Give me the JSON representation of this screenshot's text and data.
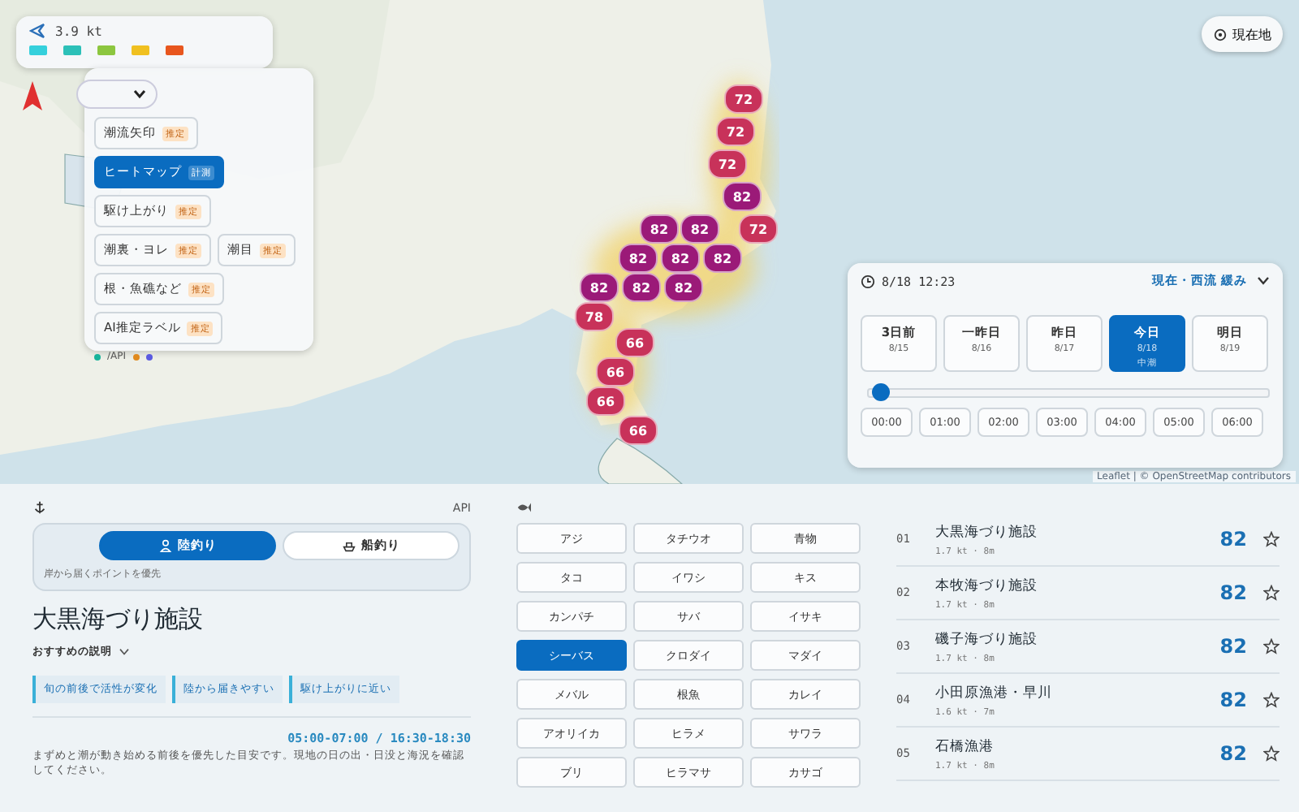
{
  "map": {
    "speed": "3.9 kt",
    "legend": [
      {
        "color": "#35d0dc"
      },
      {
        "color": "#2cc0b8"
      },
      {
        "color": "#8cc63f"
      },
      {
        "color": "#f0c020"
      },
      {
        "color": "#e8561e"
      }
    ],
    "markers": [
      {
        "label": "72"
      },
      {
        "label": "72"
      },
      {
        "label": "72"
      },
      {
        "label": "82"
      },
      {
        "label": "82"
      },
      {
        "label": "82"
      },
      {
        "label": "72"
      },
      {
        "label": "82"
      },
      {
        "label": "82"
      },
      {
        "label": "82"
      },
      {
        "label": "82"
      },
      {
        "label": "82"
      },
      {
        "label": "82"
      },
      {
        "label": "78"
      },
      {
        "label": "66"
      },
      {
        "label": "66"
      },
      {
        "label": "66"
      },
      {
        "label": "66"
      }
    ],
    "locate": "現在地",
    "attribution": "Leaflet | © OpenStreetMap contributors"
  },
  "layers": {
    "rows": [
      [
        {
          "label": "潮流矢印",
          "badge": "推定",
          "selected": false
        }
      ],
      [
        {
          "label": "ヒートマップ",
          "badge": "計測",
          "selected": true
        }
      ],
      [
        {
          "label": "駆け上がり",
          "badge": "推定",
          "selected": false
        }
      ],
      [
        {
          "label": "潮裏・ヨレ",
          "badge": "推定",
          "selected": false
        },
        {
          "label": "潮目",
          "badge": "推定",
          "selected": false
        }
      ],
      [
        {
          "label": "根・魚礁など",
          "badge": "推定",
          "selected": false
        }
      ],
      [
        {
          "label": "AI推定ラベル",
          "badge": "推定",
          "selected": false
        }
      ]
    ],
    "footer": [
      {
        "label": "/API",
        "color": "#16b39a"
      },
      {
        "color": "#e08a1e"
      },
      {
        "color": "#5a5ae0"
      }
    ]
  },
  "time_panel": {
    "datetime": "8/18 12:23",
    "status": "現在・西流 緩み",
    "days": [
      {
        "label": "3日前",
        "date": "8/15",
        "selected": false
      },
      {
        "label": "一昨日",
        "date": "8/16",
        "selected": false
      },
      {
        "label": "昨日",
        "date": "8/17",
        "selected": false
      },
      {
        "label": "今日",
        "date": "8/18",
        "tide": "中潮",
        "selected": true
      },
      {
        "label": "明日",
        "date": "8/19",
        "selected": false
      }
    ],
    "slider": {
      "level": 0.03
    },
    "hours": [
      "00:00",
      "01:00",
      "02:00",
      "03:00",
      "04:00",
      "05:00",
      "06:00"
    ]
  },
  "spot": {
    "header_right": "API",
    "modes": [
      {
        "label": "陸釣り",
        "kind": "shore",
        "selected": true
      },
      {
        "label": "船釣り",
        "kind": "boat",
        "selected": false
      }
    ],
    "mode_hint": "岸から届くポイントを優先",
    "title": "大黒海づり施設",
    "explain": "おすすめの説明",
    "tags": [
      "旬の前後で活性が変化",
      "陸から届きやすい",
      "駆け上がりに近い"
    ],
    "time_window": "05:00-07:00 / 16:30-18:30",
    "description": "まずめと潮が動き始める前後を優先した目安です。現地の日の出・日没と海況を確認してください。"
  },
  "fish": [
    {
      "label": "アジ",
      "selected": false
    },
    {
      "label": "タチウオ",
      "selected": false
    },
    {
      "label": "青物",
      "selected": false
    },
    {
      "label": "タコ",
      "selected": false
    },
    {
      "label": "イワシ",
      "selected": false
    },
    {
      "label": "キス",
      "selected": false
    },
    {
      "label": "カンパチ",
      "selected": false
    },
    {
      "label": "サバ",
      "selected": false
    },
    {
      "label": "イサキ",
      "selected": false
    },
    {
      "label": "シーバス",
      "selected": true
    },
    {
      "label": "クロダイ",
      "selected": false
    },
    {
      "label": "マダイ",
      "selected": false
    },
    {
      "label": "メバル",
      "selected": false
    },
    {
      "label": "根魚",
      "selected": false
    },
    {
      "label": "カレイ",
      "selected": false
    },
    {
      "label": "アオリイカ",
      "selected": false
    },
    {
      "label": "ヒラメ",
      "selected": false
    },
    {
      "label": "サワラ",
      "selected": false
    },
    {
      "label": "ブリ",
      "selected": false
    },
    {
      "label": "ヒラマサ",
      "selected": false
    },
    {
      "label": "カサゴ",
      "selected": false
    }
  ],
  "ranking": [
    {
      "rank": "01",
      "name": "大黒海づり施設",
      "meta": "1.7 kt · 8m",
      "score": "82"
    },
    {
      "rank": "02",
      "name": "本牧海づり施設",
      "meta": "1.7 kt · 8m",
      "score": "82"
    },
    {
      "rank": "03",
      "name": "磯子海づり施設",
      "meta": "1.7 kt · 8m",
      "score": "82"
    },
    {
      "rank": "04",
      "name": "小田原漁港・早川",
      "meta": "1.6 kt · 7m",
      "score": "82"
    },
    {
      "rank": "05",
      "name": "石橋漁港",
      "meta": "1.7 kt · 8m",
      "score": "82"
    }
  ]
}
